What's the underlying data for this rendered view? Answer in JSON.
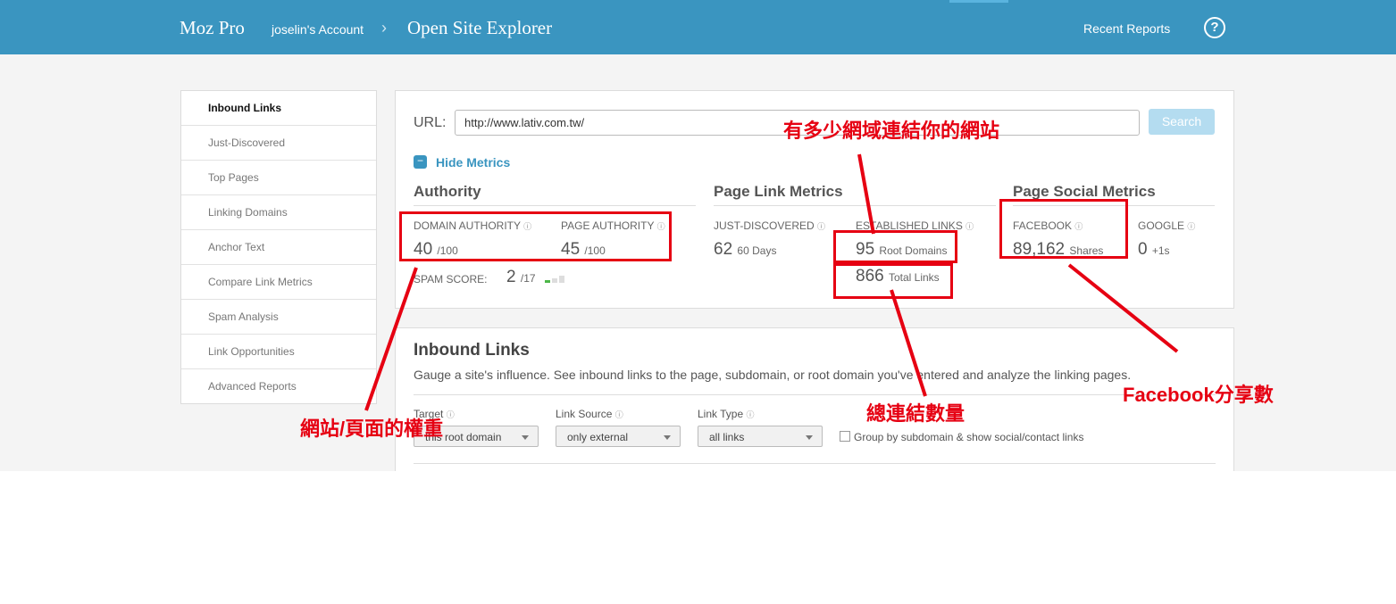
{
  "header": {
    "brand": "Moz Pro",
    "account": "joselin's Account",
    "separator": "›",
    "page_title": "Open Site Explorer",
    "recent_reports": "Recent Reports",
    "help_symbol": "?"
  },
  "sidebar": {
    "items": [
      {
        "label": "Inbound Links"
      },
      {
        "label": "Just-Discovered"
      },
      {
        "label": "Top Pages"
      },
      {
        "label": "Linking Domains"
      },
      {
        "label": "Anchor Text"
      },
      {
        "label": "Compare Link Metrics"
      },
      {
        "label": "Spam Analysis"
      },
      {
        "label": "Link Opportunities"
      },
      {
        "label": "Advanced Reports"
      }
    ]
  },
  "search": {
    "url_label": "URL:",
    "url_value": "http://www.lativ.com.tw/",
    "button": "Search"
  },
  "metrics": {
    "toggle_icon": "−",
    "toggle_label": "Hide Metrics",
    "info_symbol": "ⓘ",
    "authority": {
      "title": "Authority",
      "domain_authority_label": "DOMAIN AUTHORITY",
      "domain_authority_value": "40",
      "domain_authority_unit": "/100",
      "page_authority_label": "PAGE AUTHORITY",
      "page_authority_value": "45",
      "page_authority_unit": "/100",
      "spam_label": "SPAM SCORE:",
      "spam_value": "2",
      "spam_unit": "/17",
      "spam_score_fraction": 0.118
    },
    "page_link": {
      "title": "Page Link Metrics",
      "just_discovered_label": "JUST-DISCOVERED",
      "just_discovered_value": "62",
      "just_discovered_unit": "60 Days",
      "established_label": "ESTABLISHED LINKS",
      "root_domains_value": "95",
      "root_domains_unit": "Root Domains",
      "total_links_value": "866",
      "total_links_unit": "Total Links"
    },
    "social": {
      "title": "Page Social Metrics",
      "facebook_label": "FACEBOOK",
      "facebook_value": "89,162",
      "facebook_unit": "Shares",
      "google_label": "GOOGLE",
      "google_value": "0",
      "google_unit": "+1s"
    }
  },
  "inbound": {
    "title": "Inbound Links",
    "description": "Gauge a site's influence. See inbound links to the page, subdomain, or root domain you've entered and analyze the linking pages.",
    "target_label": "Target",
    "target_value": "this root domain",
    "source_label": "Link Source",
    "source_value": "only external",
    "type_label": "Link Type",
    "type_value": "all links",
    "group_label": "Group by subdomain & show social/contact links"
  },
  "annotations": {
    "authority_note": "網站/頁面的權重",
    "domains_note": "有多少網域連結你的網站",
    "total_links_note": "總連結數量",
    "facebook_note": "Facebook分享數",
    "color": "#e60012"
  },
  "colors": {
    "header_bg": "#3a95c0",
    "accent": "#3a95c0",
    "search_button": "#b4dcf0",
    "page_bg": "#f4f4f4"
  }
}
